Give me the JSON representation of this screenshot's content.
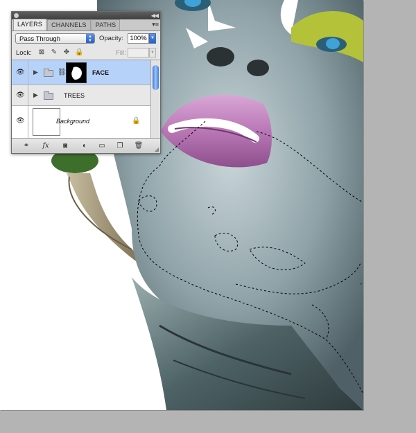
{
  "layers_panel": {
    "tabs": [
      "LAYERS",
      "CHANNELS",
      "PATHS"
    ],
    "active_tab": "LAYERS",
    "blend_mode": "Pass Through",
    "opacity_label": "Opacity:",
    "opacity_value": "100%",
    "lock_label": "Lock:",
    "fill_label": "Fill:",
    "layers": [
      {
        "name": "FACE",
        "type": "group",
        "selected": true,
        "visible": true,
        "has_mask": true
      },
      {
        "name": "TREES",
        "type": "group",
        "selected": false,
        "visible": true
      },
      {
        "name": "Background",
        "type": "layer",
        "selected": false,
        "visible": true,
        "locked": true
      }
    ],
    "footer_icons": [
      "link-layers-icon",
      "layer-style-icon",
      "add-mask-icon",
      "adjustment-layer-icon",
      "new-group-icon",
      "new-layer-icon",
      "trash-icon"
    ]
  },
  "colors": {
    "selected_row": "#b7d2f8",
    "canvas_background": "#b4b4b4",
    "document": "#ffffff",
    "lips": "#c57fc0",
    "eyeshadow": "#b4c23a",
    "iris": "#3fa3d8"
  }
}
